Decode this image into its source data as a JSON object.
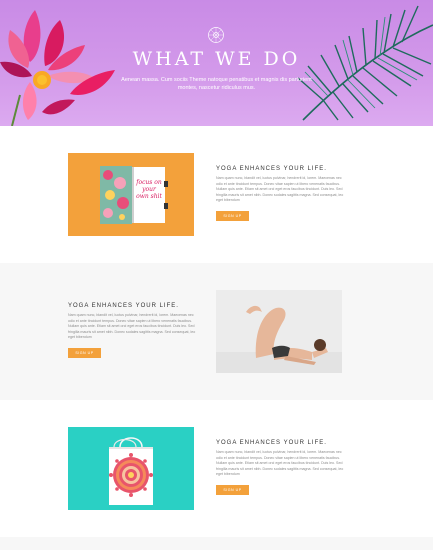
{
  "hero": {
    "title": "WHAT WE DO",
    "subtitle": "Aenean massa. Cum sociis Theme natoque penatibus et magnis dis parturient montes, nascetur ridiculus mus.",
    "background_color": "#d39aea"
  },
  "features": [
    {
      "heading": "YOGA ENHANCES YOUR LIFE.",
      "body": "Nam quam nunc, blandit vel, luctus pulvinar, hendrerit id, lorem. Maecenas nec odio et ante tincidunt tempus. Donec vitae sapien ut libero venenatis faucibus. Nullam quis ante. Etiam sit amet orci eget eros faucibus tincidunt. Duis leo. Sed fringilla mauris sit amet nibh. Donec sodales sagittis magna. Sed consequat, leo eget bibendum",
      "button": "SIGN UP",
      "image": "notebook-on-orange",
      "book_text": "focus on your own shit"
    },
    {
      "heading": "YOGA ENHANCES YOUR LIFE.",
      "body": "Nam quam nunc, blandit vel, luctus pulvinar, hendrerit id, lorem. Maecenas nec odio et ante tincidunt tempus. Donec vitae sapien ut libero venenatis faucibus. Nullam quis ante. Etiam sit amet orci eget eros faucibus tincidunt. Duis leo. Sed fringilla mauris sit amet nibh. Donec sodales sagittis magna. Sed consequat, leo eget bibendum",
      "button": "SIGN UP",
      "image": "yoga-pose"
    },
    {
      "heading": "YOGA ENHANCES YOUR LIFE.",
      "body": "Nam quam nunc, blandit vel, luctus pulvinar, hendrerit id, lorem. Maecenas nec odio et ante tincidunt tempus. Donec vitae sapien ut libero venenatis faucibus. Nullam quis ante. Etiam sit amet orci eget eros faucibus tincidunt. Duis leo. Sed fringilla mauris sit amet nibh. Donec sodales sagittis magna. Sed consequat, leo eget bibendum",
      "button": "SIGN UP",
      "image": "mandala-bag-on-teal"
    }
  ],
  "colors": {
    "accent": "#f3a13b",
    "orange_bg": "#f3a13b",
    "teal_bg": "#2ad0c4"
  }
}
